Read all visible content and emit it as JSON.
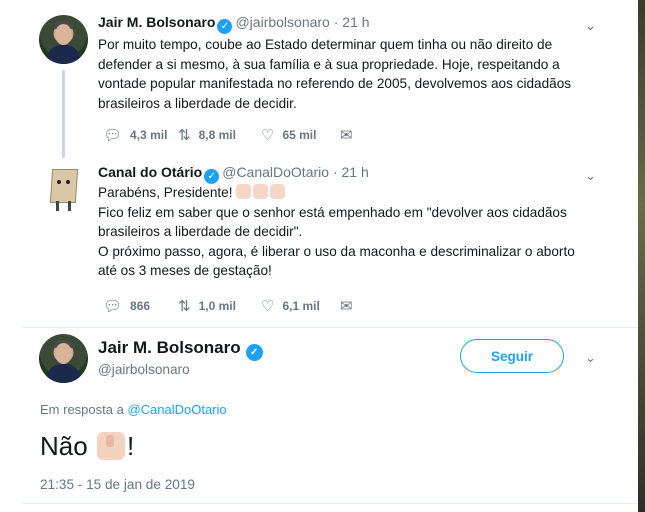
{
  "tweet1": {
    "name": "Jair M. Bolsonaro",
    "handle": "@jairbolsonaro",
    "separator": "·",
    "time": "21 h",
    "lines": [
      "Por muito tempo, coube ao Estado determinar quem tinha ou não direito de",
      "defender a si mesmo, à sua família e à sua propriedade. Hoje, respeitando a",
      "vontade popular manifestada no referendo de 2005, devolvemos aos cidadãos",
      "brasileiros a liberdade de decidir."
    ],
    "replies": "4,3 mil",
    "retweets": "8,8 mil",
    "likes": "65 mil"
  },
  "tweet2": {
    "name": "Canal do Otário",
    "handle": "@CanalDoOtario",
    "separator": "·",
    "time": "21 h",
    "line1": "Parabéns, Presidente!",
    "lines": [
      "Fico feliz em saber que o senhor está empenhado em \"devolver aos cidadãos",
      "brasileiros a liberdade de decidir\".",
      "O próximo passo, agora, é liberar o uso da maconha e descriminalizar o aborto",
      "até os 3 meses de gestação!"
    ],
    "replies": "866",
    "retweets": "1,0 mil",
    "likes": "6,1 mil"
  },
  "main": {
    "name": "Jair M. Bolsonaro",
    "handle": "@jairbolsonaro",
    "follow_label": "Seguir",
    "reply_prefix": "Em resposta a",
    "reply_handle": "@CanalDoOtario",
    "text_before": "Não",
    "text_after": "!",
    "timestamp": "21:35 - 15 de jan de 2019"
  },
  "icons": {
    "reply": "reply-icon",
    "retweet": "retweet-icon",
    "like": "heart-icon",
    "dm": "envelope-icon",
    "verified": "verified-badge-icon",
    "menu": "chevron-down-icon"
  },
  "colors": {
    "accent": "#1da1f2",
    "secondary_text": "#657786",
    "thread_line": "#c6d8e6"
  }
}
